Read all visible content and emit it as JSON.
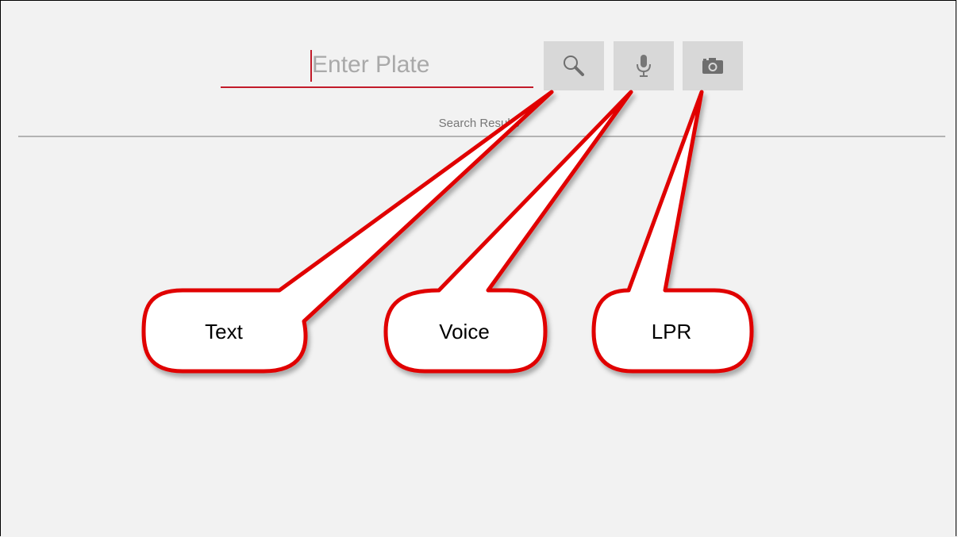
{
  "search": {
    "placeholder": "Enter Plate",
    "value": ""
  },
  "toolbar": {
    "search_icon": "search-icon",
    "voice_icon": "microphone-icon",
    "camera_icon": "camera-icon"
  },
  "results": {
    "label": "Search Results"
  },
  "callouts": {
    "text": "Text",
    "voice": "Voice",
    "lpr": "LPR"
  },
  "colors": {
    "accent": "#c21b2a",
    "button_bg": "#d8d8d8",
    "callout_border": "#e00000",
    "background": "#f2f2f2"
  }
}
